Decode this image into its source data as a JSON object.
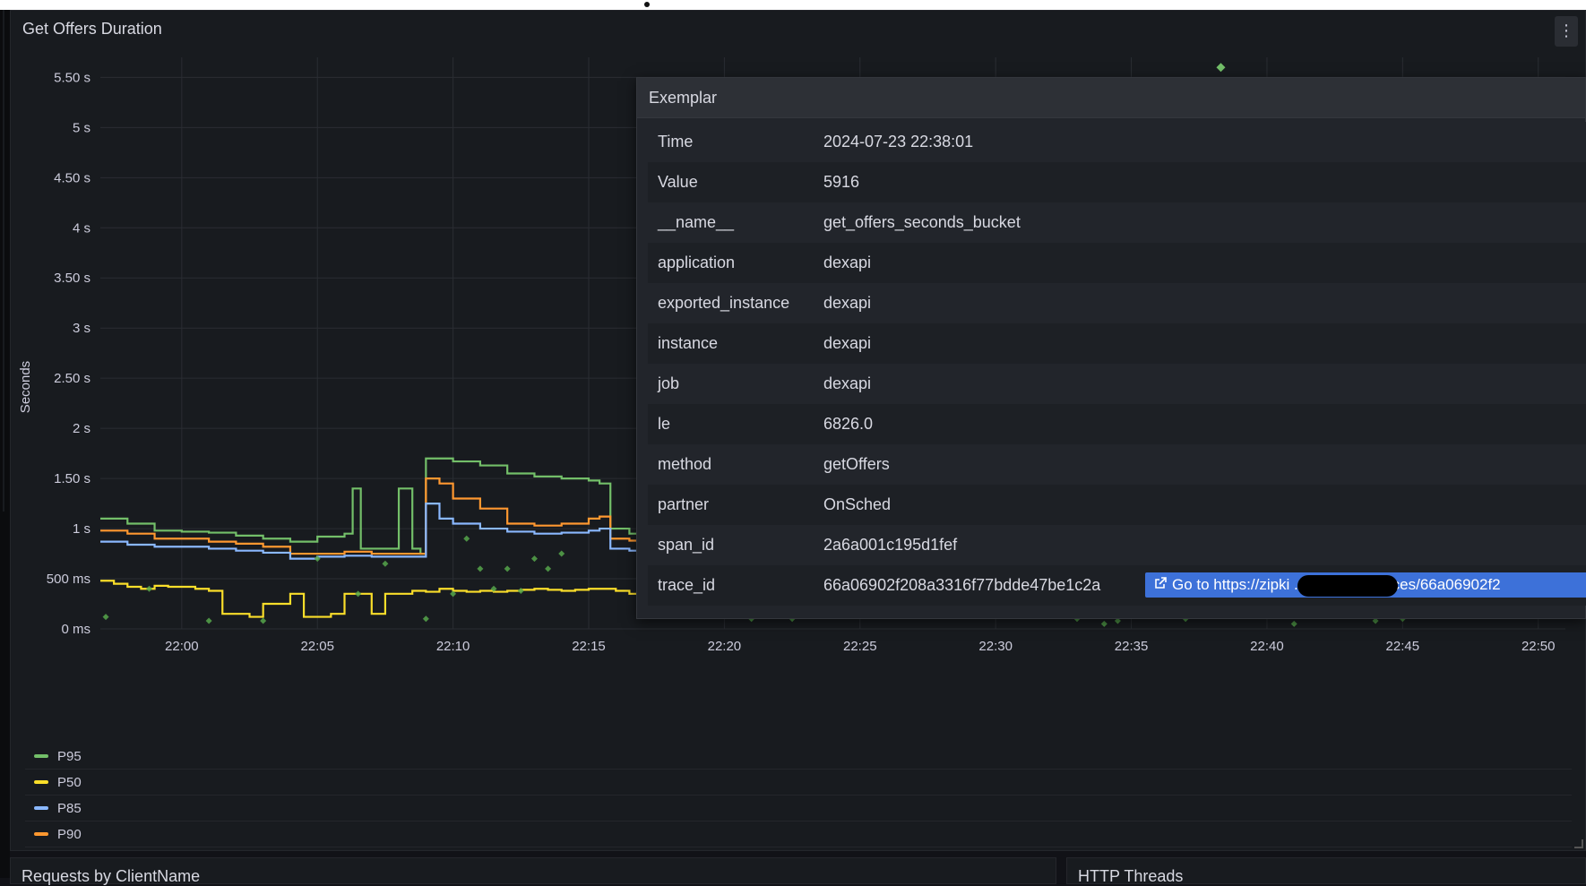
{
  "panel": {
    "title": "Get Offers Duration",
    "menu_icon": "⋮"
  },
  "bottom_panels": [
    "Requests by ClientName",
    "HTTP Threads"
  ],
  "colors": {
    "P95": "#73bf69",
    "P50": "#fade2a",
    "P85": "#8ab8ff",
    "P90": "#ff9830",
    "exemplar": "#56a64b"
  },
  "legend": [
    {
      "name": "P95",
      "color": "#73bf69"
    },
    {
      "name": "P50",
      "color": "#fade2a"
    },
    {
      "name": "P85",
      "color": "#8ab8ff"
    },
    {
      "name": "P90",
      "color": "#ff9830"
    }
  ],
  "tooltip": {
    "title": "Exemplar",
    "rows": [
      {
        "key": "Time",
        "value": "2024-07-23 22:38:01"
      },
      {
        "key": "Value",
        "value": "5916"
      },
      {
        "key": "__name__",
        "value": "get_offers_seconds_bucket"
      },
      {
        "key": "application",
        "value": "dexapi"
      },
      {
        "key": "exported_instance",
        "value": "dexapi"
      },
      {
        "key": "instance",
        "value": "dexapi"
      },
      {
        "key": "job",
        "value": "dexapi"
      },
      {
        "key": "le",
        "value": "6826.0"
      },
      {
        "key": "method",
        "value": "getOffers"
      },
      {
        "key": "partner",
        "value": "OnSched"
      },
      {
        "key": "span_id",
        "value": "2a6a001c195d1fef"
      },
      {
        "key": "trace_id",
        "value": "66a06902f208a3316f77bdde47be1c2a"
      }
    ],
    "link_text": "Go to https://zipki                    .com/zipkin/traces/66a06902f2",
    "link_icon": "external-link-icon"
  },
  "chart_data": {
    "type": "line",
    "title": "Get Offers Duration",
    "xlabel": "",
    "ylabel": "Seconds",
    "x_tick_labels": [
      "22:00",
      "22:05",
      "22:10",
      "22:15",
      "22:20",
      "22:25",
      "22:30",
      "22:35",
      "22:40",
      "22:45",
      "22:50"
    ],
    "x_ticks_min": [
      0,
      5,
      10,
      15,
      20,
      25,
      30,
      35,
      40,
      45,
      50
    ],
    "y_tick_labels": [
      "0 ms",
      "500 ms",
      "1 s",
      "1.50 s",
      "2 s",
      "2.50 s",
      "3 s",
      "3.50 s",
      "4 s",
      "4.50 s",
      "5 s",
      "5.50 s"
    ],
    "y_ticks": [
      0,
      0.5,
      1,
      1.5,
      2,
      2.5,
      3,
      3.5,
      4,
      4.5,
      5,
      5.5
    ],
    "xlim_min": [
      -3,
      51
    ],
    "ylim": [
      0,
      5.7
    ],
    "grid": true,
    "legend_position": "bottom-left",
    "series": [
      {
        "name": "P95",
        "color": "#73bf69",
        "x": [
          -3,
          -2,
          -1,
          0,
          1,
          2,
          3,
          4,
          5,
          6,
          6.3,
          6.6,
          7,
          7.5,
          8,
          8.5,
          8.8,
          9,
          10,
          11,
          12,
          13,
          14,
          15,
          15.4,
          15.8,
          16.5,
          17,
          18,
          19,
          20,
          21,
          22,
          23,
          24,
          25,
          26,
          27,
          28,
          29,
          30,
          31,
          32,
          33,
          34,
          34.5,
          35,
          36,
          37,
          38,
          39,
          40,
          41,
          42,
          43,
          44,
          45,
          46,
          47,
          48,
          49,
          50,
          51
        ],
        "values": [
          1.1,
          1.05,
          0.98,
          0.97,
          0.96,
          0.93,
          0.9,
          0.87,
          0.92,
          0.95,
          1.4,
          0.8,
          0.8,
          0.8,
          1.4,
          0.8,
          0.75,
          1.7,
          1.67,
          1.63,
          1.55,
          1.52,
          1.5,
          1.48,
          1.45,
          1.0,
          0.95,
          0.95,
          0.95,
          0.92,
          0.9,
          0.92,
          0.95,
          0.95,
          0.92,
          0.93,
          0.95,
          0.92,
          0.93,
          0.95,
          0.92,
          0.85,
          0.82,
          0.78,
          0.75,
          0.6,
          0.72,
          0.83,
          0.85,
          0.83,
          0.87,
          0.9,
          0.92,
          0.95,
          0.92,
          0.85,
          0.82,
          0.8,
          0.78,
          0.82,
          0.8,
          0.78,
          0.75
        ]
      },
      {
        "name": "P90",
        "color": "#ff9830",
        "x": [
          -3,
          -2,
          -1,
          0,
          1,
          2,
          3,
          4,
          5,
          6,
          7,
          8,
          8.8,
          9,
          9.5,
          10,
          11,
          12,
          13,
          14,
          15,
          15.4,
          15.8,
          16.5,
          17,
          18,
          19,
          20,
          21,
          22,
          23,
          24,
          25,
          26,
          27,
          28,
          29,
          30,
          31,
          32,
          33,
          34,
          34.5,
          35,
          36,
          37,
          38,
          39,
          40,
          41,
          42,
          43,
          44,
          45,
          46,
          47,
          48,
          49,
          50,
          51
        ],
        "values": [
          0.98,
          0.95,
          0.9,
          0.9,
          0.87,
          0.85,
          0.82,
          0.75,
          0.75,
          0.77,
          0.75,
          0.75,
          0.75,
          1.5,
          1.45,
          1.3,
          1.2,
          1.05,
          1.03,
          1.05,
          1.1,
          1.12,
          0.9,
          0.88,
          0.87,
          0.86,
          0.85,
          0.84,
          0.85,
          0.87,
          0.88,
          0.86,
          0.85,
          0.84,
          0.85,
          0.86,
          0.85,
          0.84,
          0.82,
          0.8,
          0.75,
          0.72,
          0.55,
          0.7,
          0.8,
          0.82,
          0.83,
          0.85,
          0.86,
          0.84,
          0.82,
          0.8,
          0.8,
          0.78,
          0.82,
          0.8,
          0.78,
          0.76,
          0.74,
          0.78
        ]
      },
      {
        "name": "P85",
        "color": "#8ab8ff",
        "x": [
          -3,
          -2,
          -1,
          0,
          1,
          2,
          3,
          4,
          5,
          6,
          7,
          8,
          8.8,
          9,
          9.5,
          10,
          11,
          12,
          13,
          14,
          15,
          15.4,
          15.8,
          16.5,
          17,
          18,
          19,
          20,
          21,
          22,
          23,
          24,
          25,
          26,
          27,
          28,
          29,
          30,
          31,
          32,
          33,
          34,
          34.5,
          35,
          36,
          37,
          38,
          39,
          40,
          41,
          42,
          43,
          44,
          45,
          46,
          47,
          48,
          49,
          50,
          51
        ],
        "values": [
          0.87,
          0.84,
          0.82,
          0.82,
          0.8,
          0.78,
          0.76,
          0.7,
          0.72,
          0.73,
          0.72,
          0.72,
          0.72,
          1.25,
          1.1,
          1.05,
          1.0,
          0.97,
          0.95,
          0.96,
          0.98,
          1.0,
          0.8,
          0.78,
          0.77,
          0.76,
          0.75,
          0.74,
          0.75,
          0.77,
          0.78,
          0.76,
          0.75,
          0.74,
          0.75,
          0.76,
          0.75,
          0.74,
          0.72,
          0.7,
          0.65,
          0.62,
          0.5,
          0.65,
          0.72,
          0.75,
          0.77,
          0.8,
          0.82,
          0.8,
          0.78,
          0.76,
          0.75,
          0.72,
          0.75,
          0.72,
          0.7,
          0.69,
          0.68,
          0.7
        ]
      },
      {
        "name": "P50",
        "color": "#fade2a",
        "x": [
          -3,
          -2.5,
          -2,
          -1.5,
          -1,
          -0.5,
          0,
          0.5,
          1,
          1.5,
          2,
          2.5,
          3,
          3.5,
          4,
          4.5,
          5,
          5.5,
          6,
          6.5,
          7,
          7.5,
          8,
          8.5,
          9,
          9.5,
          10,
          10.5,
          11,
          11.5,
          12,
          12.5,
          13,
          13.5,
          14,
          14.5,
          15,
          15.5,
          16,
          16.5,
          17,
          17.5,
          18,
          18.5,
          19,
          19.5,
          20,
          20.5,
          21,
          21.5,
          22,
          22.5,
          23,
          23.5,
          24,
          24.5,
          25,
          25.5,
          26,
          26.5,
          27,
          27.5,
          28,
          28.5,
          29,
          29.5,
          30,
          30.5,
          31,
          31.5,
          32,
          32.5,
          33,
          33.5,
          34,
          34.5,
          35,
          35.5,
          36,
          36.5,
          37,
          37.5,
          38,
          38.5,
          39,
          39.5,
          40,
          40.5,
          41,
          41.5,
          42,
          42.5,
          43,
          43.5,
          44,
          44.5,
          45,
          45.5,
          46,
          46.5,
          47,
          47.5,
          48,
          48.5,
          49,
          49.5,
          50,
          50.5,
          51
        ],
        "values": [
          0.48,
          0.45,
          0.42,
          0.4,
          0.43,
          0.42,
          0.42,
          0.4,
          0.38,
          0.15,
          0.15,
          0.12,
          0.25,
          0.25,
          0.35,
          0.12,
          0.12,
          0.15,
          0.35,
          0.35,
          0.15,
          0.35,
          0.35,
          0.38,
          0.37,
          0.4,
          0.38,
          0.37,
          0.38,
          0.37,
          0.38,
          0.39,
          0.4,
          0.39,
          0.38,
          0.39,
          0.4,
          0.4,
          0.38,
          0.35,
          0.38,
          0.35,
          0.3,
          0.3,
          0.3,
          0.15,
          0.15,
          0.3,
          0.12,
          0.3,
          0.3,
          0.35,
          0.38,
          0.38,
          0.38,
          0.37,
          0.36,
          0.37,
          0.38,
          0.39,
          0.38,
          0.38,
          0.37,
          0.38,
          0.37,
          0.36,
          0.35,
          0.36,
          0.35,
          0.32,
          0.2,
          0.18,
          0.15,
          0.12,
          0.12,
          0.15,
          0.15,
          0.35,
          0.38,
          0.38,
          0.37,
          0.36,
          0.38,
          0.39,
          0.4,
          0.41,
          0.42,
          0.41,
          0.42,
          0.41,
          0.4,
          0.38,
          0.37,
          0.35,
          0.2,
          0.2,
          0.35,
          0.12,
          0.35,
          0.12,
          0.12,
          0.15,
          0.15,
          0.15,
          0.12,
          0.35,
          0.37,
          0.38,
          0.36
        ]
      }
    ],
    "exemplars": {
      "name": "exemplars",
      "color": "#56a64b",
      "x": [
        -2.8,
        -1.2,
        1,
        3,
        5,
        6.5,
        7.5,
        9,
        10,
        10.5,
        11,
        11.5,
        12,
        12.5,
        13,
        13.5,
        14,
        17,
        19,
        21,
        22.5,
        24,
        25,
        26.5,
        28,
        30,
        31,
        32,
        33,
        34,
        34.5,
        35,
        36,
        37,
        38,
        38.3,
        39,
        40,
        41,
        42,
        44,
        45,
        46,
        47,
        48,
        49,
        50
      ],
      "values": [
        0.12,
        0.4,
        0.08,
        0.08,
        0.7,
        0.35,
        0.65,
        0.1,
        0.35,
        0.9,
        0.6,
        0.4,
        0.6,
        0.38,
        0.7,
        0.6,
        0.75,
        0.22,
        0.4,
        0.1,
        0.1,
        0.3,
        0.4,
        0.6,
        0.35,
        0.4,
        0.9,
        0.8,
        0.1,
        0.05,
        0.08,
        0.15,
        0.2,
        0.1,
        0.35,
        5.6,
        0.2,
        0.6,
        0.05,
        0.4,
        0.08,
        0.1,
        0.35,
        0.3,
        0.5,
        0.15,
        0.35
      ]
    }
  }
}
